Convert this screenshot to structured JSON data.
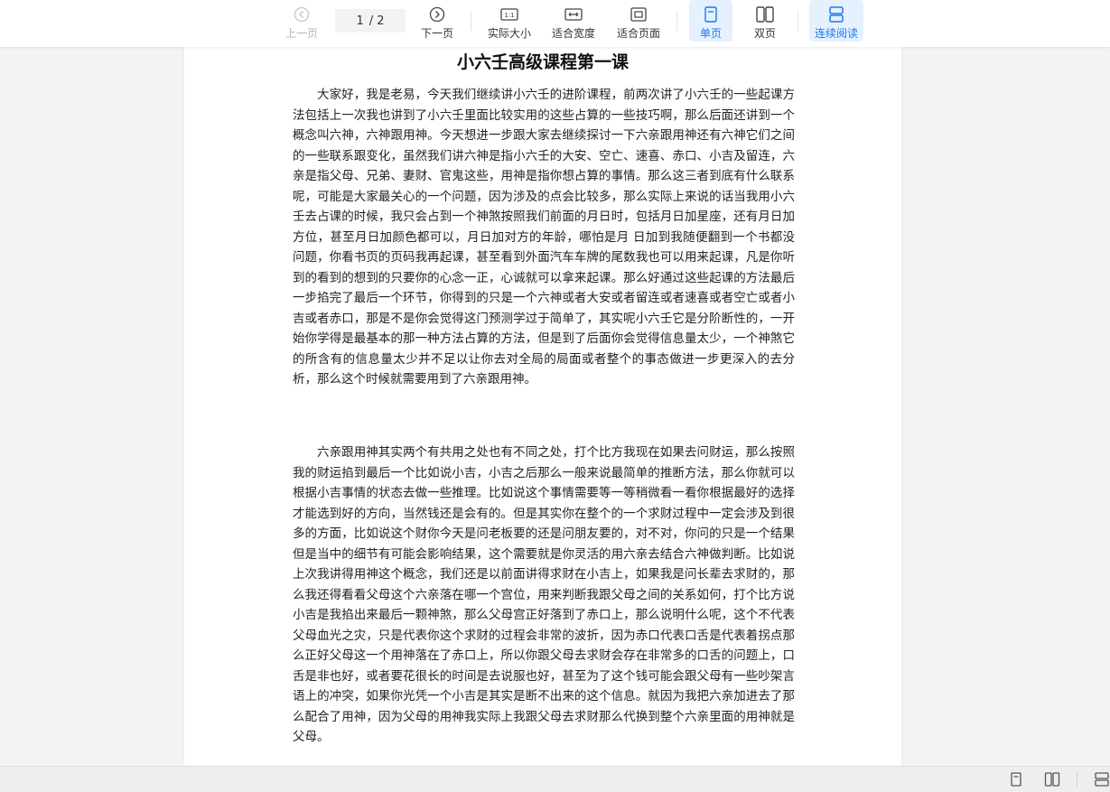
{
  "toolbar": {
    "prev_label": "上一页",
    "next_label": "下一页",
    "current_page": "1",
    "total_pages": "/ 2",
    "actual_size_label": "实际大小",
    "fit_width_label": "适合宽度",
    "fit_page_label": "适合页面",
    "single_label": "单页",
    "double_label": "双页",
    "continuous_label": "连续阅读",
    "accent_color": "#1e7ae6"
  },
  "document": {
    "title": "小六壬高级课程第一课",
    "paragraphs": [
      "大家好，我是老易，今天我们继续讲小六壬的进阶课程，前两次讲了小六壬的一些起课方法包括上一次我也讲到了小六壬里面比较实用的这些占算的一些技巧啊，那么后面还讲到一个概念叫六神，六神跟用神。今天想进一步跟大家去继续探讨一下六亲跟用神还有六神它们之间的一些联系跟变化，虽然我们讲六神是指小六壬的大安、空亡、速喜、赤口、小吉及留连，六亲是指父母、兄弟、妻财、官鬼这些，用神是指你想占算的事情。那么这三者到底有什么联系呢，可能是大家最关心的一个问题，因为涉及的点会比较多，那么实际上来说的话当我用小六壬去占课的时候，我只会占到一个神煞按照我们前面的月日时，包括月日加星座，还有月日加方位，甚至月日加颜色都可以，月日加对方的年龄，哪怕是月 日加到我随便翻到一个书都没问题，你看书页的页码我再起课，甚至看到外面汽车车牌的尾数我也可以用来起课，凡是你听到的看到的想到的只要你的心念一正，心诚就可以拿来起课。那么好通过这些起课的方法最后一步掐完了最后一个环节，你得到的只是一个六神或者大安或者留连或者速喜或者空亡或者小吉或者赤口，那是不是你会觉得这门预测学过于简单了，其实呢小六壬它是分阶断性的，一开始你学得是最基本的那一种方法占算的方法，但是到了后面你会觉得信息量太少，一个神煞它的所含有的信息量太少并不足以让你去对全局的局面或者整个的事态做进一步更深入的去分析，那么这个时候就需要用到了六亲跟用神。",
      "六亲跟用神其实两个有共用之处也有不同之处，打个比方我现在如果去问财运，那么按照我的财运掐到最后一个比如说小吉，小吉之后那么一般来说最简单的推断方法，那么你就可以根据小吉事情的状态去做一些推理。比如说这个事情需要等一等稍微看一看你根据最好的选择才能选到好的方向，当然钱还是会有的。但是其实你在整个的一个求财过程中一定会涉及到很多的方面，比如说这个财你今天是问老板要的还是问朋友要的，对不对，你问的只是一个结果但是当中的细节有可能会影响结果，这个需要就是你灵活的用六亲去结合六神做判断。比如说上次我讲得用神这个概念，我们还是以前面讲得求财在小吉上，如果我是问长辈去求财的，那么我还得看看父母这个六亲落在哪一个宫位，用来判断我跟父母之间的关系如何，打个比方说小吉是我掐出来最后一颗神煞，那么父母宫正好落到了赤口上，那么说明什么呢，这个不代表父母血光之灾，只是代表你这个求财的过程会非常的波折，因为赤口代表口舌是代表着拐点那么正好父母这一个用神落在了赤口上，所以你跟父母去求财会存在非常多的口舌的问题上，口舌是非也好，或者要花很长的时间是去说服也好，甚至为了这个钱可能会跟父母有一些吵架言语上的冲突，如果你光凭一个小吉是其实是断不出来的这个信息。就因为我把六亲加进去了那么配合了用神，因为父母的用神我实际上我跟父母去求财那么代换到整个六亲里面的用神就是父母。"
    ]
  }
}
